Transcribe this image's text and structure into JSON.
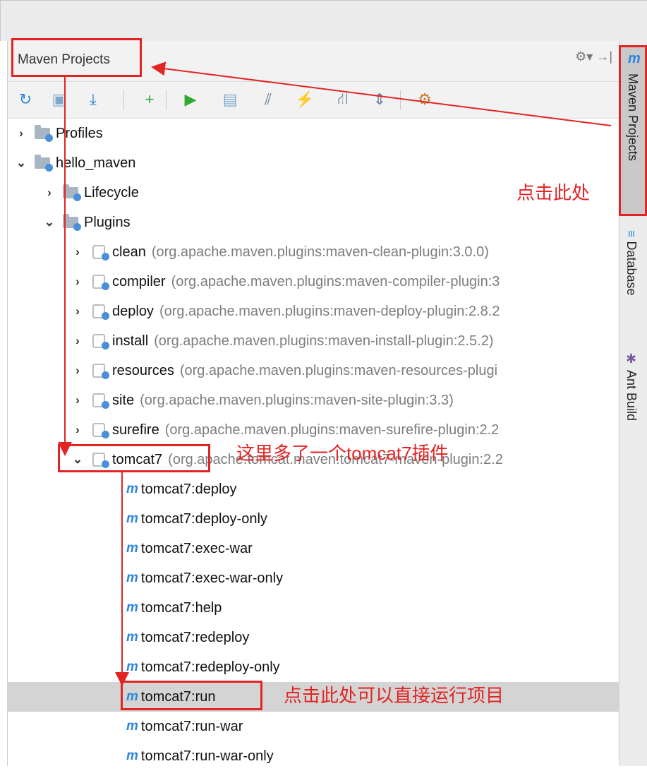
{
  "panel": {
    "title": "Maven Projects",
    "header_icons": "⚙▾  →|"
  },
  "toolbar": {
    "buttons": [
      {
        "name": "reimport",
        "glyph": "↻",
        "color": "#2e86de"
      },
      {
        "name": "generate-sources",
        "glyph": "▣",
        "color": "#7ea7c9"
      },
      {
        "name": "download",
        "glyph": "⤓",
        "color": "#2e86de"
      },
      {
        "name": "add",
        "glyph": "+",
        "color": "#2eaa2e"
      },
      {
        "name": "run",
        "glyph": "▶",
        "color": "#2eaa2e"
      },
      {
        "name": "execute-goal",
        "glyph": "▤",
        "color": "#7ea7c9"
      },
      {
        "name": "toggle-offline",
        "glyph": "⫽",
        "color": "#6a7d9a"
      },
      {
        "name": "skip-tests",
        "glyph": "⚡",
        "color": "#2e86de"
      },
      {
        "name": "dependencies",
        "glyph": "⛙",
        "color": "#6a7d9a"
      },
      {
        "name": "collapse-all",
        "glyph": "⇕",
        "color": "#6a7d9a"
      },
      {
        "name": "settings",
        "glyph": "⚙",
        "color": "#c77a2e"
      }
    ]
  },
  "tree": [
    {
      "label": "Profiles",
      "detail": "",
      "level": 0,
      "chevron": "›",
      "icon": "folder"
    },
    {
      "label": "hello_maven",
      "detail": "",
      "level": 0,
      "chevron": "⌄",
      "icon": "module"
    },
    {
      "label": "Lifecycle",
      "detail": "",
      "level": 1,
      "chevron": "›",
      "icon": "folder"
    },
    {
      "label": "Plugins",
      "detail": "",
      "level": 1,
      "chevron": "⌄",
      "icon": "folder"
    },
    {
      "label": "clean",
      "detail": "(org.apache.maven.plugins:maven-clean-plugin:3.0.0)",
      "level": 2,
      "chevron": "›",
      "icon": "plugin"
    },
    {
      "label": "compiler",
      "detail": "(org.apache.maven.plugins:maven-compiler-plugin:3",
      "level": 2,
      "chevron": "›",
      "icon": "plugin"
    },
    {
      "label": "deploy",
      "detail": "(org.apache.maven.plugins:maven-deploy-plugin:2.8.2",
      "level": 2,
      "chevron": "›",
      "icon": "plugin"
    },
    {
      "label": "install",
      "detail": "(org.apache.maven.plugins:maven-install-plugin:2.5.2)",
      "level": 2,
      "chevron": "›",
      "icon": "plugin"
    },
    {
      "label": "resources",
      "detail": "(org.apache.maven.plugins:maven-resources-plugi",
      "level": 2,
      "chevron": "›",
      "icon": "plugin"
    },
    {
      "label": "site",
      "detail": "(org.apache.maven.plugins:maven-site-plugin:3.3)",
      "level": 2,
      "chevron": "›",
      "icon": "plugin"
    },
    {
      "label": "surefire",
      "detail": "(org.apache.maven.plugins:maven-surefire-plugin:2.2",
      "level": 2,
      "chevron": "›",
      "icon": "plugin"
    },
    {
      "label": "tomcat7",
      "detail": "(org.apache.tomcat.maven:tomcat7-maven-plugin:2.2",
      "level": 2,
      "chevron": "⌄",
      "icon": "plugin"
    },
    {
      "label": "tomcat7:deploy",
      "detail": "",
      "level": 3,
      "chevron": "",
      "icon": "goal"
    },
    {
      "label": "tomcat7:deploy-only",
      "detail": "",
      "level": 3,
      "chevron": "",
      "icon": "goal"
    },
    {
      "label": "tomcat7:exec-war",
      "detail": "",
      "level": 3,
      "chevron": "",
      "icon": "goal"
    },
    {
      "label": "tomcat7:exec-war-only",
      "detail": "",
      "level": 3,
      "chevron": "",
      "icon": "goal"
    },
    {
      "label": "tomcat7:help",
      "detail": "",
      "level": 3,
      "chevron": "",
      "icon": "goal"
    },
    {
      "label": "tomcat7:redeploy",
      "detail": "",
      "level": 3,
      "chevron": "",
      "icon": "goal"
    },
    {
      "label": "tomcat7:redeploy-only",
      "detail": "",
      "level": 3,
      "chevron": "",
      "icon": "goal"
    },
    {
      "label": "tomcat7:run",
      "detail": "",
      "level": 3,
      "chevron": "",
      "icon": "goal",
      "selected": true
    },
    {
      "label": "tomcat7:run-war",
      "detail": "",
      "level": 3,
      "chevron": "",
      "icon": "goal"
    },
    {
      "label": "tomcat7:run-war-only",
      "detail": "",
      "level": 3,
      "chevron": "",
      "icon": "goal"
    }
  ],
  "right_tabs": {
    "maven": "Maven Projects",
    "database": "Database",
    "ant": "Ant Build",
    "maven_glyph": "m"
  },
  "annotations": {
    "click_here": "点击此处",
    "plugin_added": "这里多了一个tomcat7插件",
    "run_directly": "点击此处可以直接运行项目",
    "color": "#e32424"
  }
}
